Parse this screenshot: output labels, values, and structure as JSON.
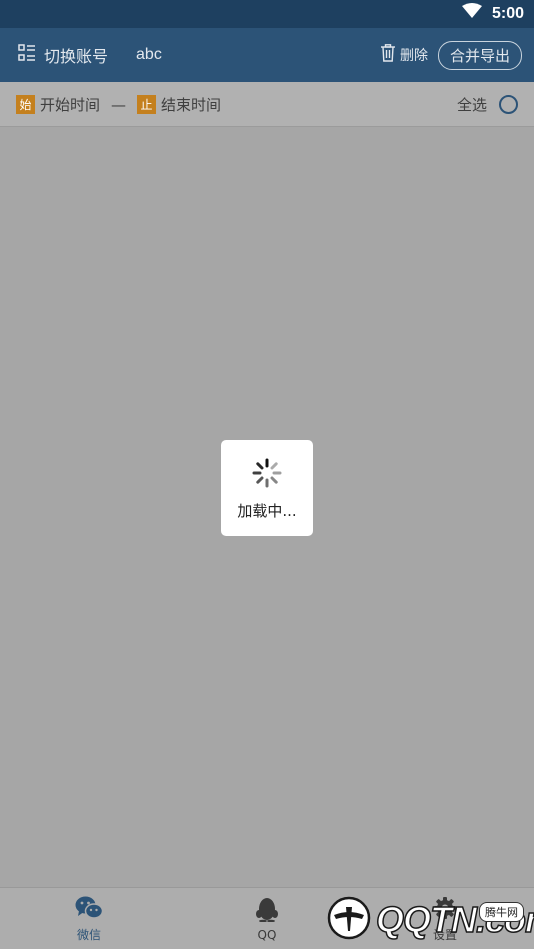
{
  "status_bar": {
    "time": "5:00",
    "wifi_icon": "wifi-icon"
  },
  "header": {
    "switch_account_label": "切换账号",
    "account_name": "abc",
    "delete_label": "删除",
    "merge_export_label": "合并导出"
  },
  "filter": {
    "start_tag": "始",
    "start_time_label": "开始时间",
    "separator": "—",
    "end_tag": "止",
    "end_time_label": "结束时间",
    "select_all_label": "全选",
    "select_all_checked": false
  },
  "loading": {
    "text": "加载中..."
  },
  "bottom_nav": {
    "tabs": [
      {
        "label": "微信",
        "icon": "wechat-icon",
        "active": true
      },
      {
        "label": "QQ",
        "icon": "qq-penguin-icon",
        "active": false
      },
      {
        "label": "设置",
        "icon": "gear-icon",
        "active": false
      }
    ]
  },
  "watermark": {
    "logo_text": "QQTN.com",
    "badge": "腾牛网"
  },
  "colors": {
    "header_bg": "#2c5377",
    "status_bg": "#1e4060",
    "tag_orange": "#c4801e",
    "overlay_gray": "#a6a6a6"
  }
}
